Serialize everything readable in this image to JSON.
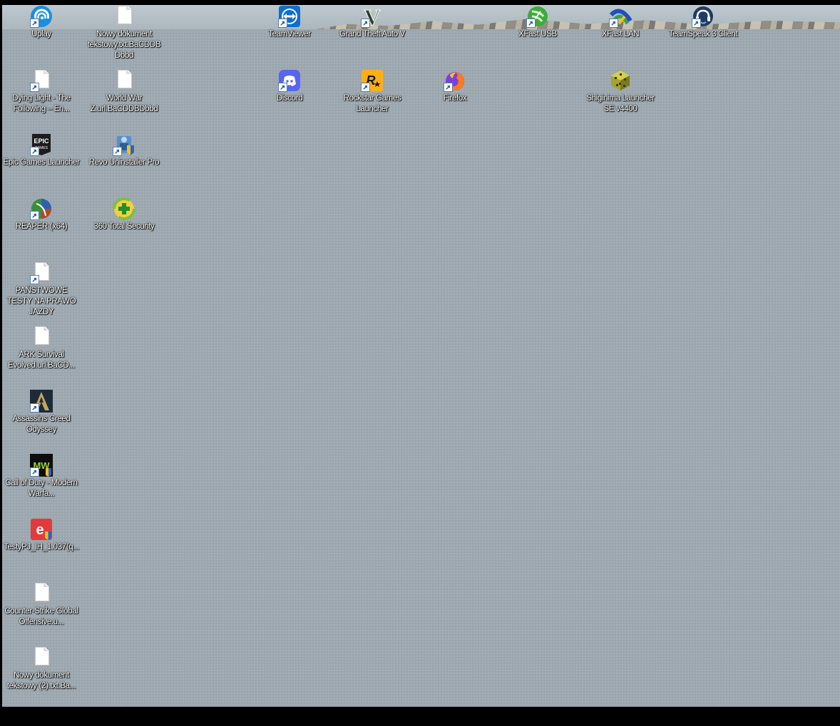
{
  "desktop": {
    "icons": [
      {
        "label": "Uplay"
      },
      {
        "label": "Nowy dokument tekstowy.txt.BaCDDB Dbbd"
      },
      {
        "label": "TeamViewer"
      },
      {
        "label": "Grand Theft Auto V"
      },
      {
        "label": "XFast USB"
      },
      {
        "label": "XFast LAN"
      },
      {
        "label": "TeamSpeak 3 Client"
      },
      {
        "label": "Dying Light - The Following – En..."
      },
      {
        "label": "World War Z.url.BaCDDBDbbd"
      },
      {
        "label": "Discord"
      },
      {
        "label": "Rockstar Games Launcher"
      },
      {
        "label": "Firefox"
      },
      {
        "label": "Shiginima Launcher SE v4400"
      },
      {
        "label": "Epic Games Launcher"
      },
      {
        "label": "Revo Uninstaller Pro"
      },
      {
        "label": "REAPER (x64)"
      },
      {
        "label": "360 Total Security"
      },
      {
        "label": "PAŃSTWOWE TESTY NA PRAWO JAZDY"
      },
      {
        "label": "ARK Survival Evolved.url.BaCD..."
      },
      {
        "label": "Assassins Creed Odyssey"
      },
      {
        "label": "Call of Duty - Modern Warfa..."
      },
      {
        "label": "TestyPJ_IH_1.037(q..."
      },
      {
        "label": "Counter-Strike Global Offensive.u..."
      },
      {
        "label": "Nowy dokument tekstowy (2).txt.Ba..."
      }
    ],
    "icon_names": {
      "uplay": "uplay-icon",
      "document": "document-icon",
      "teamviewer": "teamviewer-icon",
      "gta": "gta-v-icon",
      "xfast_usb": "xfast-usb-icon",
      "xfast_lan": "xfast-lan-icon",
      "teamspeak": "teamspeak-icon",
      "discord": "discord-icon",
      "rockstar": "rockstar-icon",
      "firefox": "firefox-icon",
      "shiginima": "shiginima-icon",
      "epic": "epic-games-icon",
      "revo": "revo-uninstaller-icon",
      "reaper": "reaper-icon",
      "security360": "360-security-icon",
      "ac_odyssey": "assassins-creed-icon",
      "cod": "call-of-duty-icon",
      "testy": "testy-pj-icon",
      "shortcut_arrow": "shortcut-arrow-icon"
    },
    "colors": {
      "background": "#9ba6ae",
      "label_text": "#ffffff",
      "taskbar": "#000000"
    }
  }
}
